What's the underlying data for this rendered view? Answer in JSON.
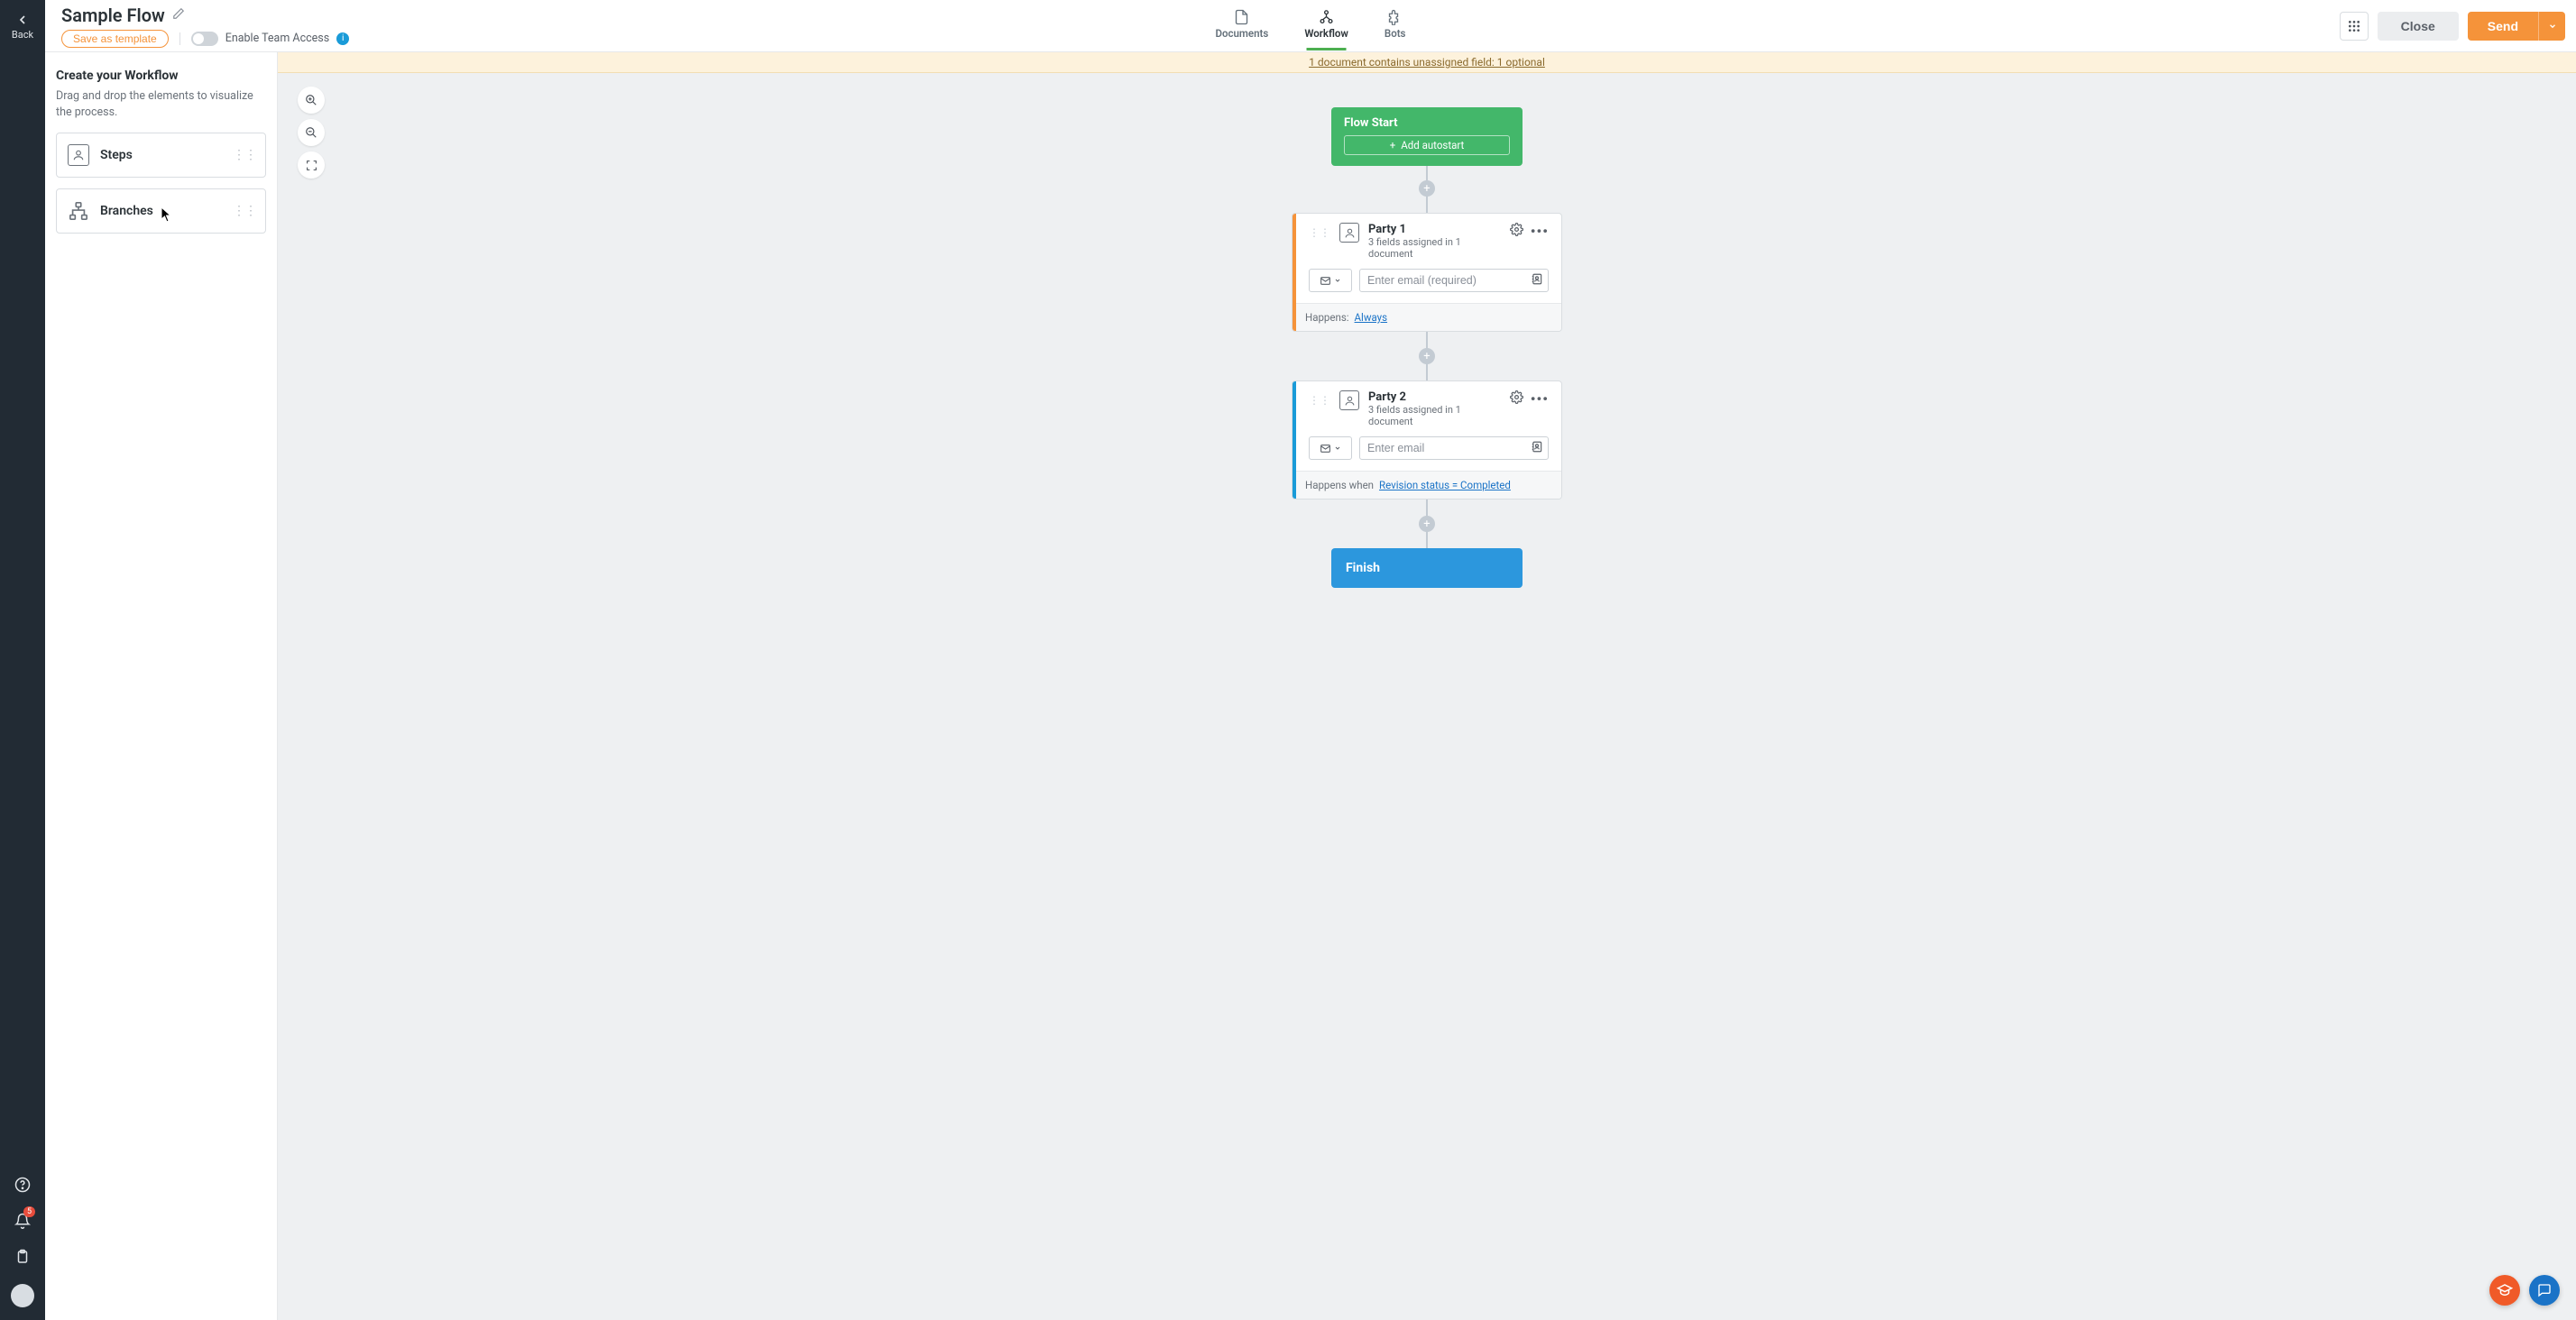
{
  "header": {
    "back_label": "Back",
    "title": "Sample Flow",
    "save_template_label": "Save as template",
    "team_access_label": "Enable Team Access"
  },
  "nav": {
    "tabs": [
      {
        "label": "Documents"
      },
      {
        "label": "Workflow"
      },
      {
        "label": "Bots"
      }
    ]
  },
  "actions": {
    "close_label": "Close",
    "send_label": "Send"
  },
  "sidebar": {
    "notification_count": "5"
  },
  "panel": {
    "title": "Create your Workflow",
    "subtitle": "Drag and drop the elements to visualize the process.",
    "items": [
      {
        "label": "Steps"
      },
      {
        "label": "Branches"
      }
    ]
  },
  "banner": {
    "text": "1 document contains unassigned field: 1 optional"
  },
  "flow": {
    "start": {
      "title": "Flow Start",
      "autostart_label": "Add autostart"
    },
    "steps": [
      {
        "title": "Party 1",
        "subtitle": "3 fields assigned in 1 document",
        "placeholder": "Enter email (required)",
        "happens_prefix": "Happens:",
        "condition_text": "Always"
      },
      {
        "title": "Party 2",
        "subtitle": "3 fields assigned in 1 document",
        "placeholder": "Enter email",
        "happens_prefix": "Happens when",
        "condition_text": "Revision status = Completed"
      }
    ],
    "finish_label": "Finish"
  }
}
